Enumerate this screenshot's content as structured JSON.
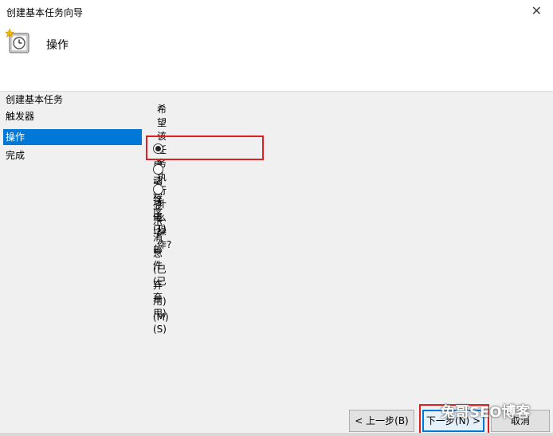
{
  "window": {
    "title": "创建基本任务向导",
    "close_glyph": "✕"
  },
  "header": {
    "title": "操作"
  },
  "sidebar": {
    "items": [
      {
        "label": "创建基本任务"
      },
      {
        "label": "触发器"
      },
      {
        "label": "操作"
      },
      {
        "label": "完成"
      }
    ],
    "active_index": 2
  },
  "main": {
    "question": "希望该任务执行什么操作?",
    "options": [
      {
        "label": "启动程序(T)",
        "checked": true
      },
      {
        "label": "发送电子邮件(已弃用)(S)",
        "checked": false
      },
      {
        "label": "显示消息(已弃用)(M)",
        "checked": false
      }
    ]
  },
  "buttons": {
    "back": "< 上一步(B)",
    "next": "下一步(N) >",
    "cancel": "取消"
  },
  "watermark": "兔哥SEO博客",
  "colors": {
    "selection": "#0078d7",
    "highlight": "#e02020"
  }
}
